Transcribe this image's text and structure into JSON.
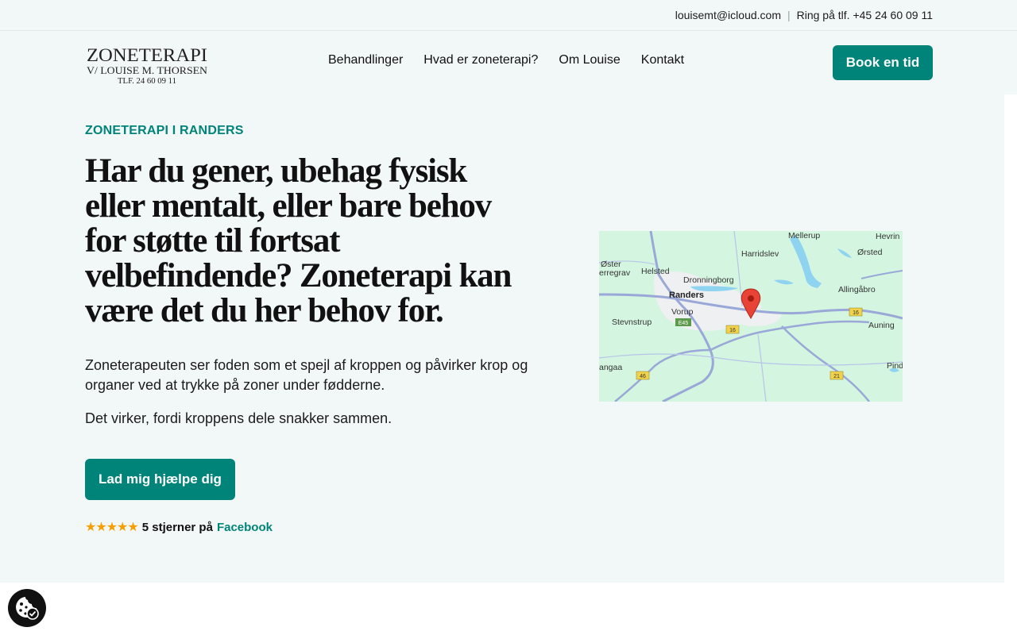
{
  "topbar": {
    "email": "louisemt@icloud.com",
    "separator": "|",
    "phone_text": "Ring på tlf. +45 24 60 09 11"
  },
  "logo": {
    "line1": "ZONETERAPI",
    "line2": "V/ LOUISE M. THORSEN",
    "line3": "TLF. 24 60 09 11"
  },
  "nav": {
    "items": [
      {
        "label": "Behandlinger"
      },
      {
        "label": "Hvad er zoneterapi?"
      },
      {
        "label": "Om Louise"
      },
      {
        "label": "Kontakt"
      }
    ],
    "book_label": "Book en tid"
  },
  "hero": {
    "eyebrow": "ZONETERAPI I RANDERS",
    "headline": "Har du gener, ubehag fysisk eller mentalt, eller bare behov for støtte til fortsat velbefindende? Zoneterapi kan være det du her behov for.",
    "paragraph1": "Zoneterapeuten ser foden som et spejl af kroppen og påvirker krop og organer ved at trykke på zoner under fødderne.",
    "paragraph2": "Det virker, fordi kroppens dele snakker sammen.",
    "cta_label": "Lad mig hjælpe dig",
    "stars": "★★★★★",
    "rating_text": "5 stjerner på",
    "rating_link": "Facebook"
  },
  "map": {
    "labels": [
      "Mellerup",
      "Hevrin",
      "Harridslev",
      "Ørsted",
      "Øster",
      "erregrav",
      "Helsted",
      "Dronningborg",
      "Allingåbro",
      "Randers",
      "Vorup",
      "Stevnstrup",
      "Auning",
      "angaa",
      "Pind"
    ],
    "road_labels": [
      "E45",
      "16",
      "16",
      "46",
      "21"
    ]
  },
  "colors": {
    "accent": "#00847a",
    "background": "#f2f7f7",
    "star": "#f5a000"
  },
  "icons": {
    "cookie": "cookie-icon",
    "map_pin": "map-pin-icon"
  }
}
